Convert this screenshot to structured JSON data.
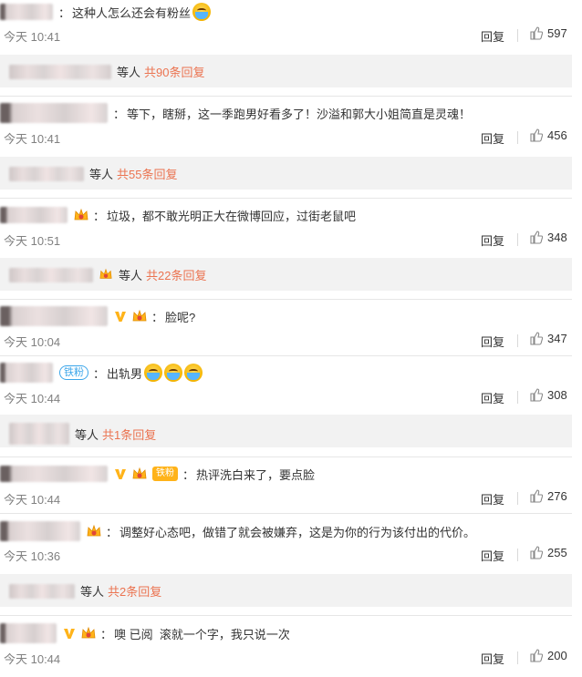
{
  "comments": [
    {
      "text": "这种人怎么还会有粉丝",
      "time": "今天 10:41",
      "reply": "回复",
      "likes": "597",
      "sub_etc": "等人",
      "sub_more": "共90条回复"
    },
    {
      "text": "等下，瞎掰，这一季跑男好看多了！沙溢和郭大小姐简直是灵魂！",
      "time": "今天 10:41",
      "reply": "回复",
      "likes": "456",
      "sub_etc": "等人",
      "sub_more": "共55条回复"
    },
    {
      "text": "垃圾，都不敢光明正大在微博回应，过街老鼠吧",
      "time": "今天 10:51",
      "reply": "回复",
      "likes": "348",
      "sub_etc": "等人",
      "sub_more": "共22条回复"
    },
    {
      "text": "脸呢?",
      "time": "今天 10:04",
      "reply": "回复",
      "likes": "347"
    },
    {
      "text": "出轨男",
      "badge": "铁粉",
      "time": "今天 10:44",
      "reply": "回复",
      "likes": "308",
      "sub_etc": "等人",
      "sub_more": "共1条回复"
    },
    {
      "text": "热评洗白来了，要点脸",
      "badge": "铁粉",
      "time": "今天 10:44",
      "reply": "回复",
      "likes": "276"
    },
    {
      "text": "调整好心态吧，做错了就会被嫌弃，这是为你的行为该付出的代价。",
      "time": "今天 10:36",
      "reply": "回复",
      "likes": "255",
      "sub_etc": "等人",
      "sub_more": "共2条回复"
    },
    {
      "text": "噢 已阅  滚就一个字，我只说一次",
      "time": "今天 10:44",
      "reply": "回复",
      "likes": "200"
    }
  ],
  "colors": {
    "link": "#eb7350",
    "meta": "#808080",
    "sub_bg": "#f2f2f2",
    "vip": "#ffb319",
    "fan_badge": "#3ca6ea"
  },
  "icons": {
    "like": "thumbs-up-icon",
    "vip": "v-verified-icon",
    "member": "crown-member-icon",
    "emoji": "crying-emoji-icon"
  }
}
